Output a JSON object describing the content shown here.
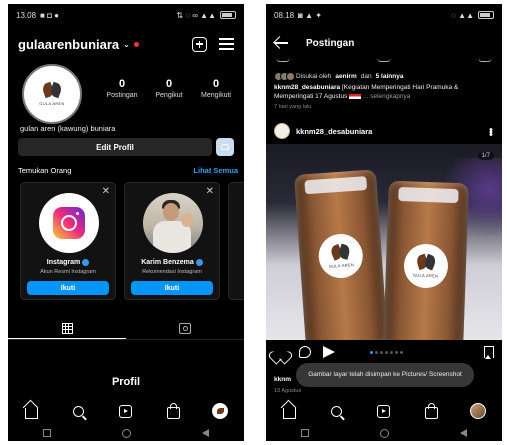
{
  "left": {
    "status_time": "13.08",
    "username": "gulaarenbuniara",
    "avatar_logo_text": "GULA AREN",
    "stats": [
      {
        "num": "0",
        "label": "Postingan"
      },
      {
        "num": "0",
        "label": "Pengikut"
      },
      {
        "num": "0",
        "label": "Mengikuti"
      }
    ],
    "bio_name": "gulan aren (kawung) buniara",
    "edit_profile_label": "Edit Profil",
    "discover_label": "Temukan Orang",
    "see_all_label": "Lihat Semua",
    "suggestions": [
      {
        "name": "Instagram",
        "subtitle": "Akun Resmi Instagram",
        "follow": "Ikuti"
      },
      {
        "name": "Karim Benzema",
        "subtitle": "Rekomendasi Instagram",
        "follow": "Ikuti"
      }
    ],
    "bottom_title": "Profil"
  },
  "right": {
    "status_time": "08.18",
    "header_title": "Postingan",
    "liked_prefix": "Disukai oleh",
    "liked_user": "aenirm",
    "liked_and": "dan",
    "liked_others": "5 lainnya",
    "caption_user": "kknm28_desabuniara",
    "caption_text": "[Kegiatan Memperingati Hari Pramuka & Memperingati 17 Agustus",
    "caption_more": "... selengkapnya",
    "time_ago": "7 hari yang lalu",
    "post_author": "kknm28_desabuniara",
    "bag_logo_text": "GULA AREN",
    "page_indicator": "1/7",
    "next_author": "kknm",
    "next_date": "13 Agustus",
    "toast": "Gambar layar telah disimpan ke Pictures/ Screenshot"
  },
  "colors": {
    "background": "#000000",
    "accent_blue": "#0095f6",
    "link_blue": "#2fa3f5",
    "notification_red": "#ff3040"
  }
}
